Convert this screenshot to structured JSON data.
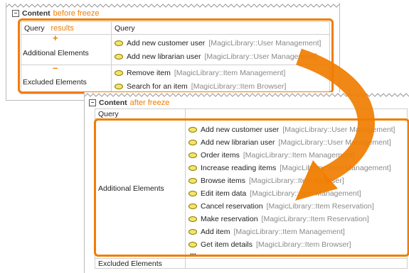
{
  "panel1": {
    "header_title": "Content",
    "annotation": "before freeze",
    "query_label": "Query",
    "query_annotation": "results",
    "query_value": "Query",
    "additional_label": "Additional Elements",
    "additional_marker": "+",
    "excluded_label": "Excluded Elements",
    "excluded_marker": "–",
    "additional_items": [
      {
        "name": "Add new  customer user",
        "path": "[MagicLibrary::User Management]"
      },
      {
        "name": "Add new  librarian user",
        "path": "[MagicLibrary::User Management]"
      }
    ],
    "excluded_items": [
      {
        "name": "Remove item",
        "path": "[MagicLibrary::Item Management]"
      },
      {
        "name": "Search for an item",
        "path": "[MagicLibrary::Item Browser]"
      }
    ]
  },
  "panel2": {
    "header_title": "Content",
    "annotation": "after freeze",
    "query_label": "Query",
    "additional_label": "Additional Elements",
    "excluded_label": "Excluded Elements",
    "ellipsis": "...",
    "items": [
      {
        "name": "Add new  customer user",
        "path": "[MagicLibrary::User Management]"
      },
      {
        "name": "Add new  librarian user",
        "path": "[MagicLibrary::User Management]"
      },
      {
        "name": "Order items",
        "path": "[MagicLibrary::Item Management]"
      },
      {
        "name": "Increase reading items",
        "path": "[MagicLibrary::Item Management]"
      },
      {
        "name": "Browse items",
        "path": "[MagicLibrary::Item Browser]"
      },
      {
        "name": "Edit item data",
        "path": "[MagicLibrary::Item Management]"
      },
      {
        "name": "Cancel reservation",
        "path": "[MagicLibrary::Item Reservation]"
      },
      {
        "name": "Make reservation",
        "path": "[MagicLibrary::Item Reservation]"
      },
      {
        "name": "Add item",
        "path": "[MagicLibrary::Item Management]"
      },
      {
        "name": "Get item details",
        "path": "[MagicLibrary::Item Browser]"
      }
    ]
  },
  "colors": {
    "accent": "#f07d00",
    "border": "#cfcfcf"
  }
}
